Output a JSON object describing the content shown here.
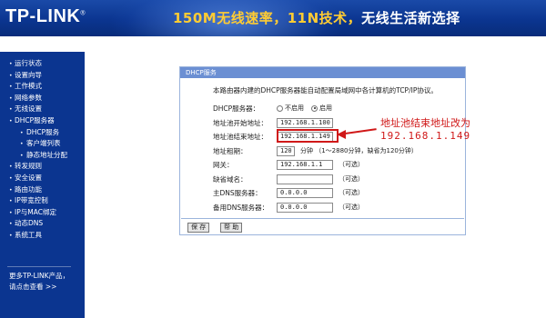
{
  "header": {
    "logo": "TP-LINK",
    "logo_mark": "®",
    "slogan_accent": "150M无线速率，11N技术，",
    "slogan_rest": "无线生活新选择"
  },
  "sidebar": {
    "items": [
      {
        "label": "运行状态",
        "sub": false
      },
      {
        "label": "设置向导",
        "sub": false
      },
      {
        "label": "工作模式",
        "sub": false
      },
      {
        "label": "网络参数",
        "sub": false
      },
      {
        "label": "无线设置",
        "sub": false
      },
      {
        "label": "DHCP服务器",
        "sub": false
      },
      {
        "label": "DHCP服务",
        "sub": true
      },
      {
        "label": "客户端列表",
        "sub": true
      },
      {
        "label": "静态地址分配",
        "sub": true
      },
      {
        "label": "转发规则",
        "sub": false
      },
      {
        "label": "安全设置",
        "sub": false
      },
      {
        "label": "路由功能",
        "sub": false
      },
      {
        "label": "IP带宽控制",
        "sub": false
      },
      {
        "label": "IP与MAC绑定",
        "sub": false
      },
      {
        "label": "动态DNS",
        "sub": false
      },
      {
        "label": "系统工具",
        "sub": false
      }
    ],
    "more_line1": "更多TP-LINK产品，",
    "more_line2": "请点击查看 >>"
  },
  "panel": {
    "title": "DHCP服务",
    "description": "本路由器内建的DHCP服务器能自动配置局域网中各计算机的TCP/IP协议。",
    "dhcp_label": "DHCP服务器：",
    "radio_off": "不启用",
    "radio_on": "启用",
    "pool_start_label": "地址池开始地址：",
    "pool_start_value": "192.168.1.100",
    "pool_end_label": "地址池结束地址：",
    "pool_end_value": "192.168.1.149",
    "lease_label": "地址租期：",
    "lease_value": "120",
    "lease_hint": "分钟 （1～2880分钟，缺省为120分钟）",
    "gateway_label": "网关：",
    "gateway_value": "192.168.1.1",
    "optional": "（可选）",
    "domain_label": "缺省域名：",
    "domain_value": "",
    "dns1_label": "主DNS服务器：",
    "dns1_value": "0.0.0.0",
    "dns2_label": "备用DNS服务器：",
    "dns2_value": "0.0.0.0",
    "save_button": "保 存",
    "help_button": "帮 助"
  },
  "annotation": {
    "line1": "地址池结束地址改为",
    "line2": "192.168.1.149"
  },
  "colors": {
    "brand_blue": "#0b3590",
    "annotation_red": "#d01818"
  }
}
